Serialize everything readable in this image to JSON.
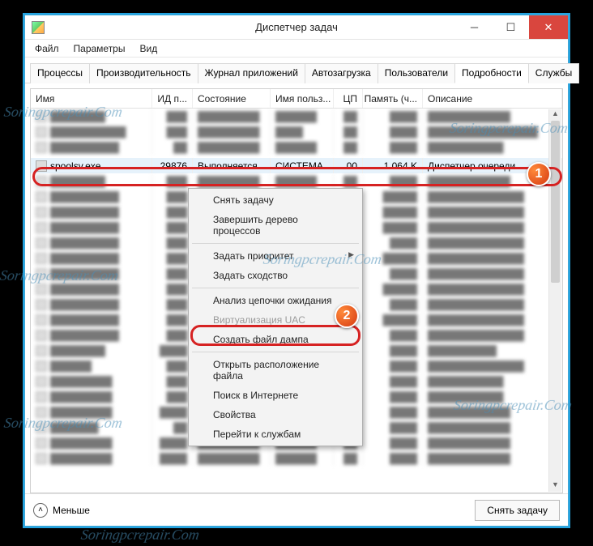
{
  "window": {
    "title": "Диспетчер задач"
  },
  "menus": [
    "Файл",
    "Параметры",
    "Вид"
  ],
  "tabs": [
    {
      "label": "Процессы"
    },
    {
      "label": "Производительность"
    },
    {
      "label": "Журнал приложений"
    },
    {
      "label": "Автозагрузка"
    },
    {
      "label": "Пользователи"
    },
    {
      "label": "Подробности",
      "active": true
    },
    {
      "label": "Службы"
    }
  ],
  "columns": {
    "name": "Имя",
    "pid": "ИД п...",
    "state": "Состояние",
    "user": "Имя польз...",
    "cpu": "ЦП",
    "mem": "Память (ч...",
    "desc": "Описание"
  },
  "selected_row": {
    "name": "spoolsv.exe",
    "pid": "29876",
    "state": "Выполняется",
    "user": "СИСТЕМА",
    "cpu": "00",
    "mem": "1 064 K",
    "desc": "Диспетчер очереди"
  },
  "context_menu": [
    {
      "label": "Снять задачу"
    },
    {
      "label": "Завершить дерево процессов"
    },
    {
      "sep": true
    },
    {
      "label": "Задать приоритет",
      "submenu": true
    },
    {
      "label": "Задать сходство"
    },
    {
      "sep": true
    },
    {
      "label": "Анализ цепочки ожидания"
    },
    {
      "label": "Виртуализация UAC",
      "disabled": true
    },
    {
      "label": "Создать файл дампа"
    },
    {
      "sep": true
    },
    {
      "label": "Открыть расположение файла",
      "highlighted": true
    },
    {
      "label": "Поиск в Интернете"
    },
    {
      "label": "Свойства"
    },
    {
      "label": "Перейти к службам"
    }
  ],
  "footer": {
    "less_label": "Меньше",
    "end_task_label": "Снять задачу"
  },
  "annotations": {
    "badge1": "1",
    "badge2": "2"
  },
  "watermark_text": "Soringpcrepair.Com",
  "colors": {
    "highlight": "#d62222",
    "badge_bg": "#e04a18",
    "window_border": "#23a3e0"
  }
}
